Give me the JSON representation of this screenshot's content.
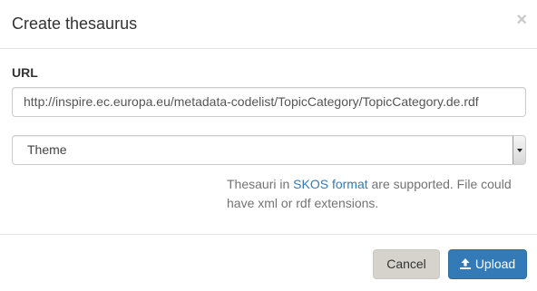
{
  "dialog": {
    "title": "Create thesaurus",
    "close_symbol": "×"
  },
  "url_field": {
    "label": "URL",
    "value": "http://inspire.ec.europa.eu/metadata-codelist/TopicCategory/TopicCategory.de.rdf"
  },
  "type_select": {
    "selected": "Theme"
  },
  "help": {
    "prefix": "Thesauri in ",
    "link_text": "SKOS format",
    "suffix": " are supported. File could have xml or rdf extensions."
  },
  "footer": {
    "cancel_label": "Cancel",
    "upload_label": "Upload",
    "upload_icon": "upload-icon"
  },
  "colors": {
    "primary": "#337ab7",
    "link": "#337ab7",
    "cancel_bg": "#d6d3cc"
  }
}
